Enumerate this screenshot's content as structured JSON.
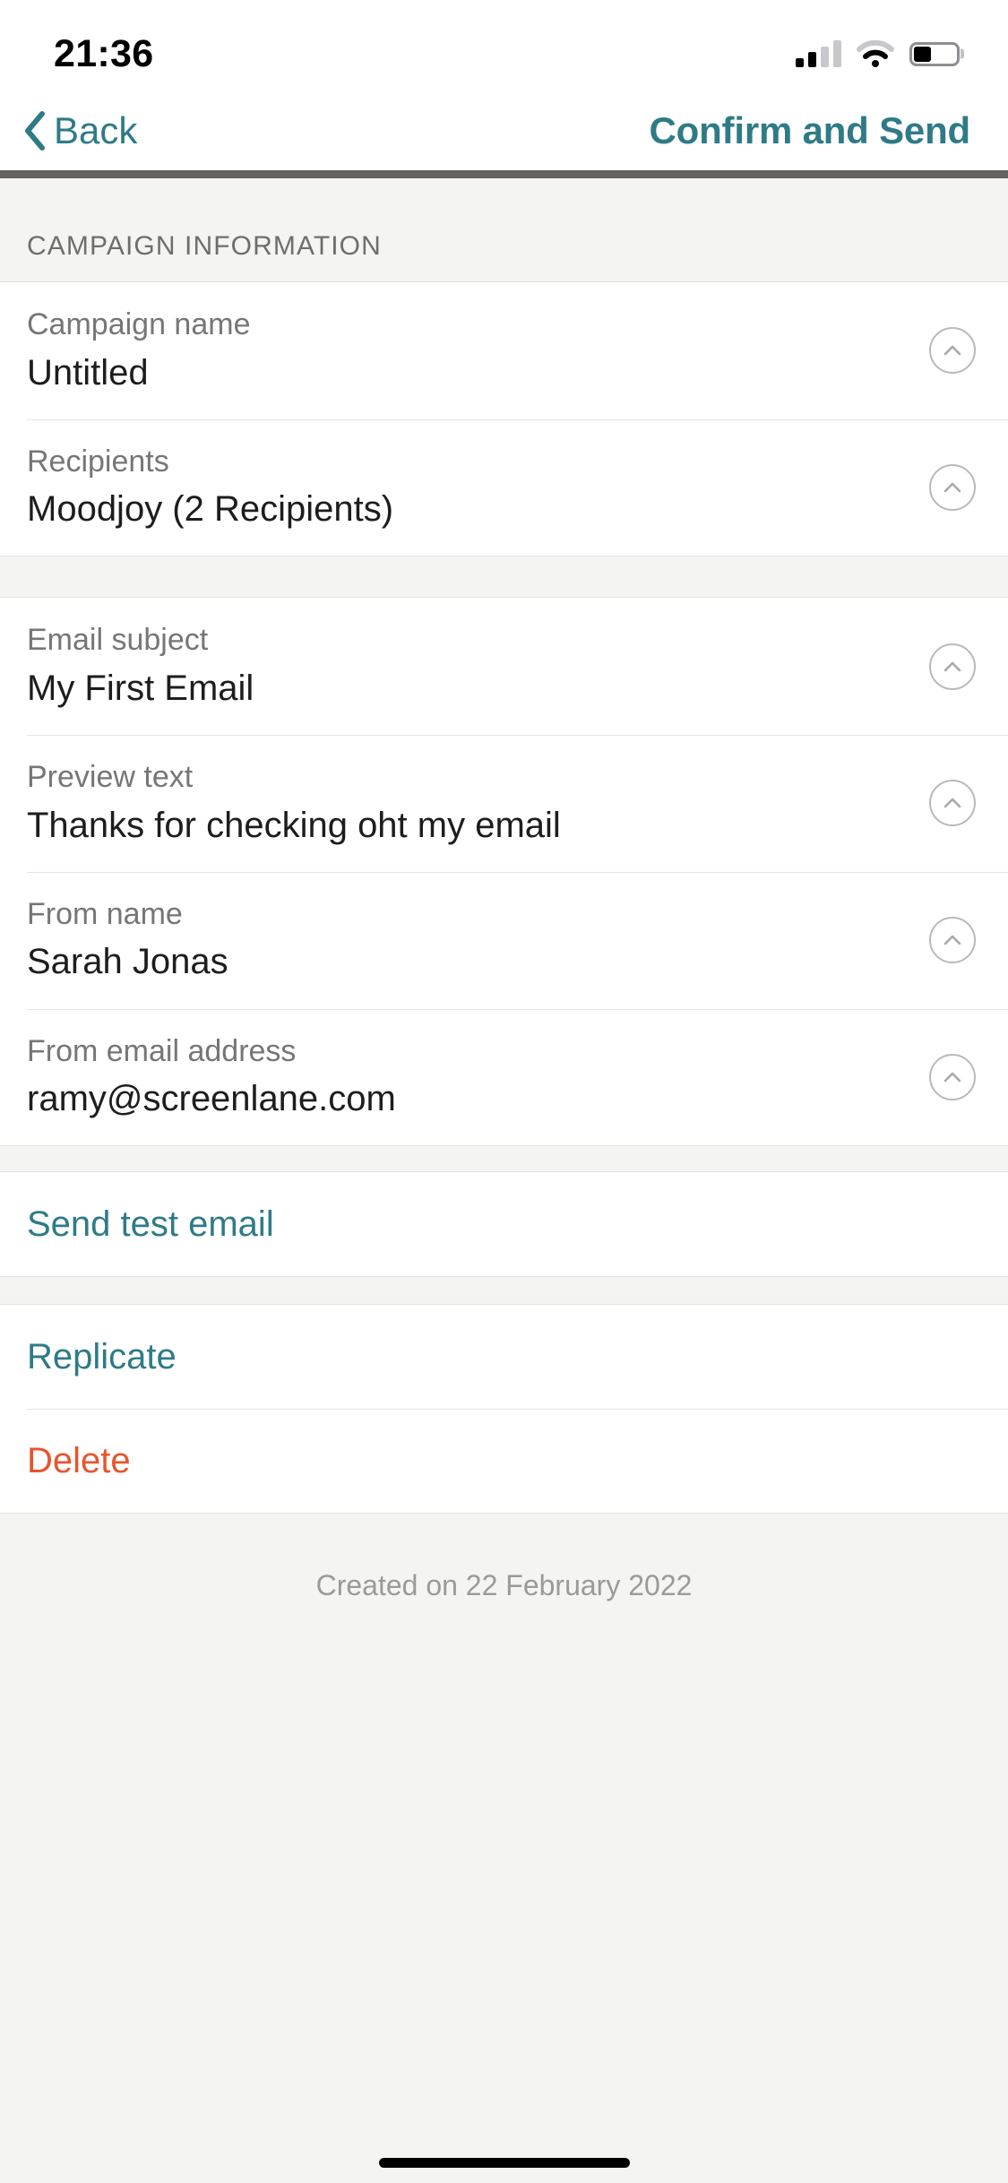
{
  "status_bar": {
    "time": "21:36",
    "cellular_icon": "cellular-signal-icon",
    "wifi_icon": "wifi-icon",
    "battery_icon": "battery-icon"
  },
  "nav": {
    "back_label": "Back",
    "back_icon": "chevron-left-icon",
    "title": "Confirm and Send",
    "accent_color": "#2e7b87"
  },
  "sections": {
    "campaign_information_header": "CAMPAIGN INFORMATION"
  },
  "campaign_rows": [
    {
      "label": "Campaign name",
      "value": "Untitled",
      "icon": "chevron-up-circle-icon"
    },
    {
      "label": "Recipients",
      "value": "Moodjoy (2 Recipients)",
      "icon": "chevron-up-circle-icon"
    }
  ],
  "email_rows": [
    {
      "label": "Email subject",
      "value": "My First Email",
      "icon": "chevron-up-circle-icon"
    },
    {
      "label": "Preview text",
      "value": "Thanks for checking oht my email",
      "icon": "chevron-up-circle-icon"
    },
    {
      "label": "From name",
      "value": "Sarah Jonas",
      "icon": "chevron-up-circle-icon"
    },
    {
      "label": "From email address",
      "value": "ramy@screenlane.com",
      "icon": "chevron-up-circle-icon"
    }
  ],
  "actions": {
    "send_test_email": "Send test email",
    "replicate": "Replicate",
    "delete": "Delete",
    "delete_color": "#e8552d"
  },
  "footer": {
    "created_on": "Created on 22 February 2022"
  },
  "home_indicator": "home-indicator"
}
